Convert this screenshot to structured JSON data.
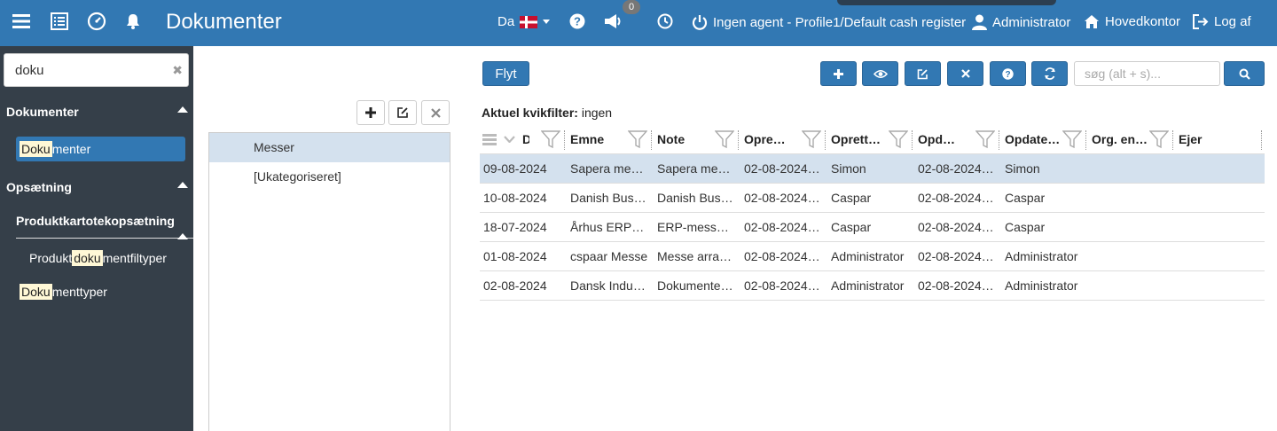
{
  "header": {
    "title": "Dokumenter",
    "language": "Da",
    "badge_count": "0",
    "agent_label": "Ingen agent - Profile1/Default cash register",
    "user_label": "Administrator",
    "home_label": "Hovedkontor",
    "logout_label": "Log af"
  },
  "sidebar": {
    "search_value": "doku",
    "sections": [
      {
        "label": "Dokumenter"
      },
      {
        "label": "Opsætning"
      },
      {
        "label": "Produktkartotekopsætning"
      }
    ],
    "items": [
      {
        "pre": "",
        "hl": "Doku",
        "post": "menter"
      },
      {
        "pre": "Produkt",
        "hl": "doku",
        "post": "mentfiltyper"
      },
      {
        "pre": "",
        "hl": "Doku",
        "post": "menttyper"
      }
    ]
  },
  "tree": {
    "items": [
      {
        "label": "Messer",
        "selected": true
      },
      {
        "label": "[Ukategoriseret]",
        "selected": false
      }
    ]
  },
  "toolbar": {
    "move_label": "Flyt",
    "search_placeholder": "søg (alt + s)..."
  },
  "quickfilter": {
    "label": "Aktuel kvikfilter:",
    "value": "ingen"
  },
  "grid": {
    "columns": [
      "D",
      "Emne",
      "Note",
      "Opre…",
      "Oprett…",
      "Opd…",
      "Opdate…",
      "Org. en…",
      "Ejer"
    ],
    "rows": [
      {
        "selected": true,
        "cells": [
          "09-08-2024",
          "Sapera me…",
          "Sapera me…",
          "02-08-2024…",
          "Simon",
          "02-08-2024…",
          "Simon",
          "",
          ""
        ]
      },
      {
        "selected": false,
        "cells": [
          "10-08-2024",
          "Danish Bus…",
          "Danish Bus…",
          "02-08-2024…",
          "Caspar",
          "02-08-2024…",
          "Caspar",
          "",
          ""
        ]
      },
      {
        "selected": false,
        "cells": [
          "18-07-2024",
          "Århus ERP…",
          "ERP-mess…",
          "02-08-2024…",
          "Caspar",
          "02-08-2024…",
          "Caspar",
          "",
          ""
        ]
      },
      {
        "selected": false,
        "cells": [
          "01-08-2024",
          "cspaar Messe",
          "Messe arra…",
          "02-08-2024…",
          "Administrator",
          "02-08-2024…",
          "Administrator",
          "",
          ""
        ]
      },
      {
        "selected": false,
        "cells": [
          "02-08-2024",
          "Dansk Indu…",
          "Dokumente…",
          "02-08-2024…",
          "Administrator",
          "02-08-2024…",
          "Administrator",
          "",
          ""
        ]
      }
    ]
  },
  "colors": {
    "primary": "#3278b3",
    "sidebar": "#353f49",
    "selected_row": "#d4e1ee",
    "highlight": "#fff8d6"
  }
}
